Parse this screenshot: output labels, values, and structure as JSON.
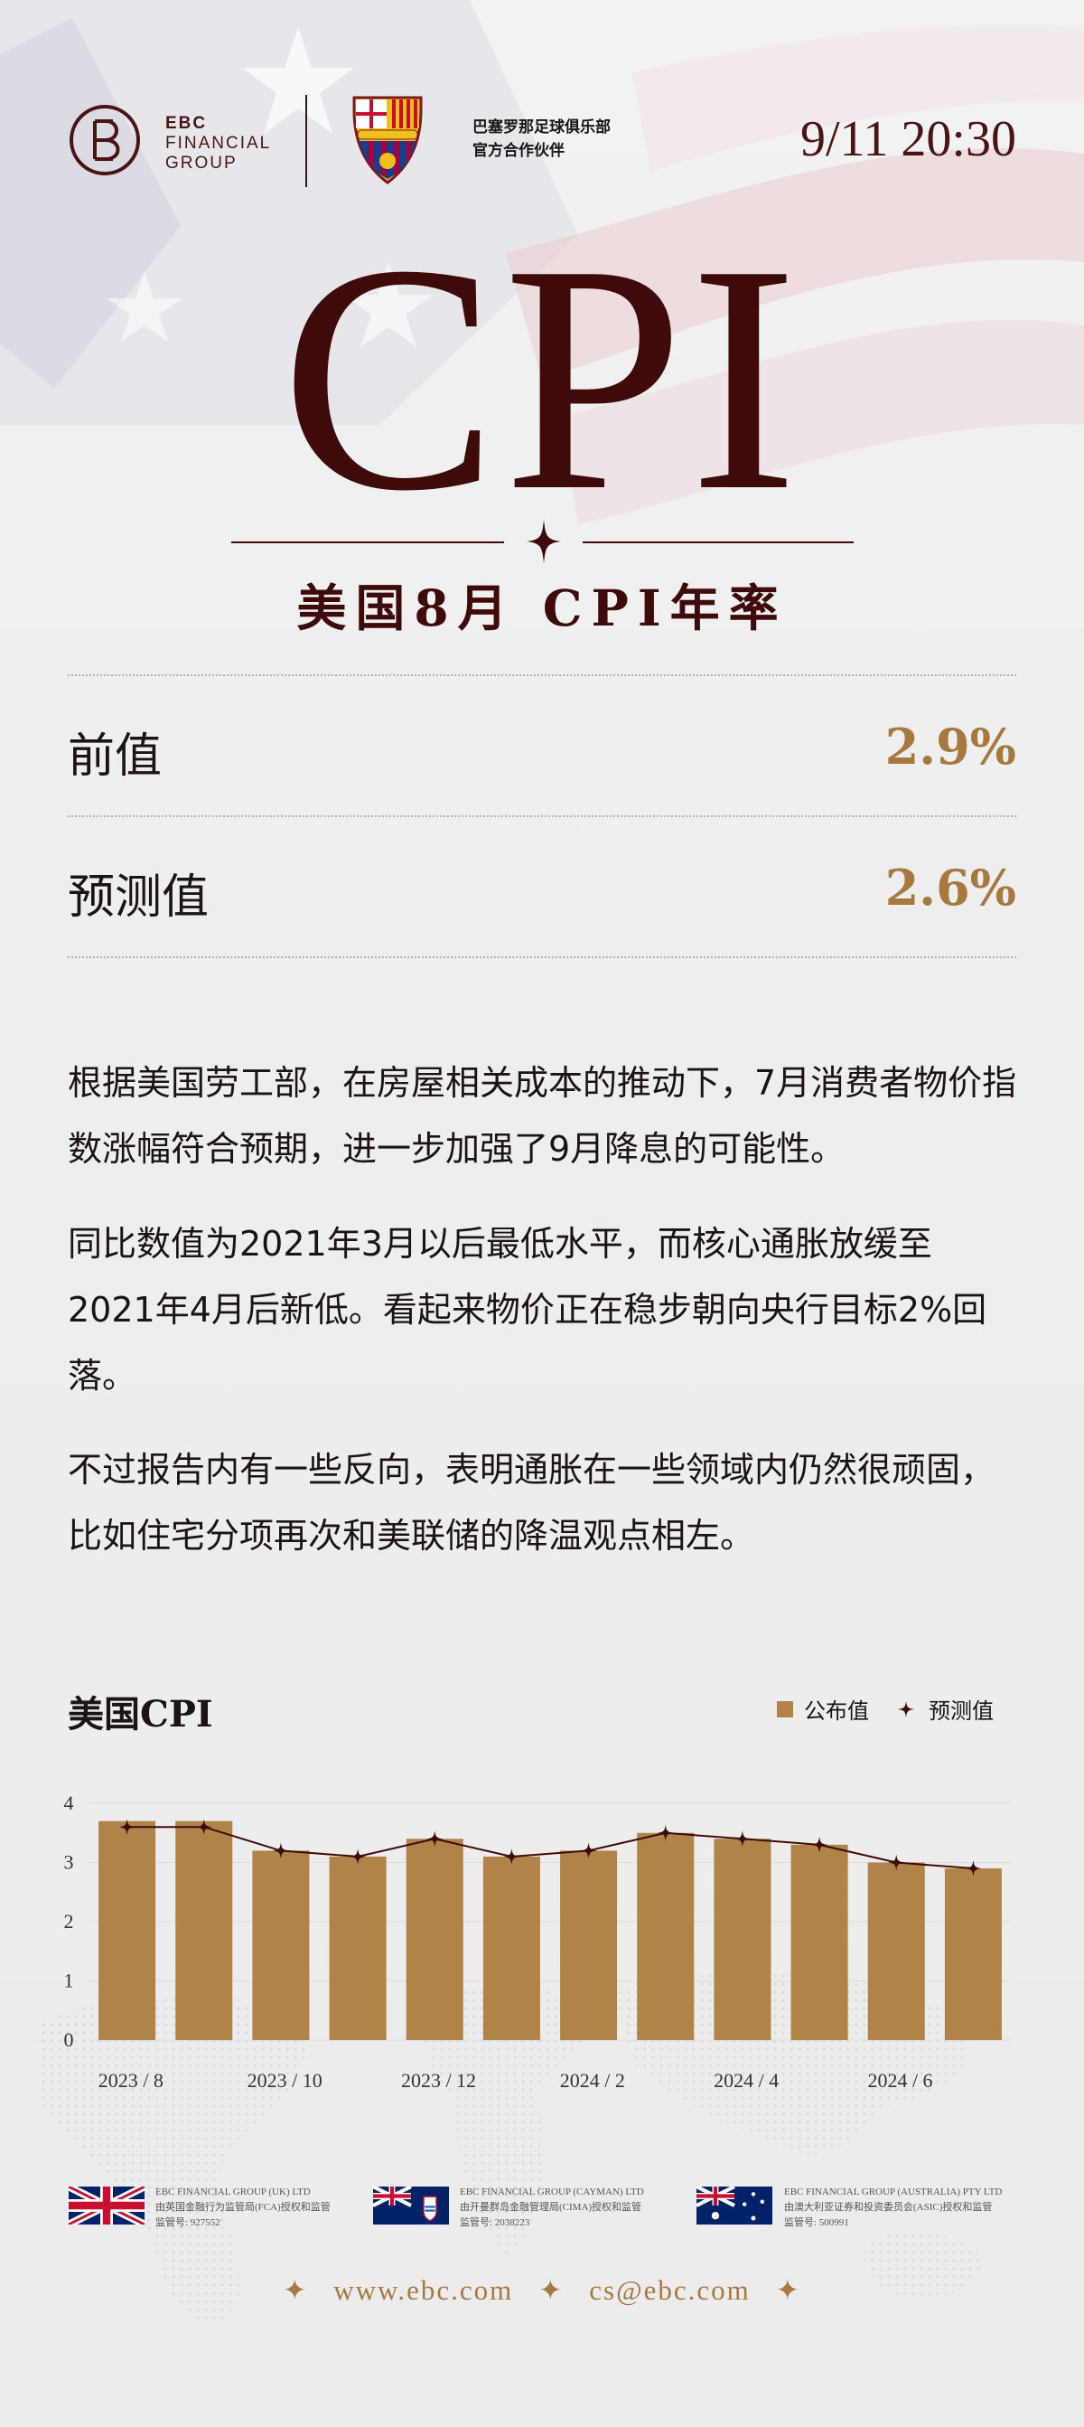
{
  "header": {
    "brand_line1": "EBC",
    "brand_line2": "FINANCIAL",
    "brand_line3": "GROUP",
    "partner_line1": "巴塞罗那足球俱乐部",
    "partner_line2": "官方合作伙伴",
    "datetime": "9/11 20:30"
  },
  "hero": {
    "title": "CPI",
    "subtitle": "美国8月 CPI年率"
  },
  "stats": [
    {
      "label": "前值",
      "value": "2.9%"
    },
    {
      "label": "预测值",
      "value": "2.6%"
    }
  ],
  "body": {
    "paragraphs": [
      "根据美国劳工部，在房屋相关成本的推动下，7月消费者物价指数涨幅符合预期，进一步加强了9月降息的可能性。",
      "同比数值为2021年3月以后最低水平，而核心通胀放缓至2021年4月后新低。看起来物价正在稳步朝向央行目标2%回落。",
      "不过报告内有一些反向，表明通胀在一些领域内仍然很顽固，比如住宅分项再次和美联储的降温观点相左。"
    ]
  },
  "chart_data": {
    "type": "bar",
    "title": "美国CPI",
    "categories": [
      "2023/8",
      "2023/9",
      "2023/10",
      "2023/11",
      "2023/12",
      "2024/1",
      "2024/2",
      "2024/3",
      "2024/4",
      "2024/5",
      "2024/6",
      "2024/7"
    ],
    "tick_labels": [
      "2023 / 8",
      "2023 / 10",
      "2023 / 12",
      "2024 / 2",
      "2024 / 4",
      "2024 / 6"
    ],
    "series": [
      {
        "name": "公布值",
        "type": "bar",
        "color": "#b08349",
        "values": [
          3.7,
          3.7,
          3.2,
          3.1,
          3.4,
          3.1,
          3.2,
          3.5,
          3.4,
          3.3,
          3.0,
          2.9
        ]
      },
      {
        "name": "预测值",
        "type": "line",
        "color": "#3e0a0a",
        "values": [
          3.6,
          3.6,
          3.2,
          3.1,
          3.4,
          3.1,
          3.2,
          3.5,
          3.4,
          3.3,
          3.0,
          2.9
        ]
      }
    ],
    "ylim": [
      0,
      4
    ],
    "yticks": [
      "0",
      "1",
      "2",
      "3",
      "4"
    ],
    "legend_position": "top-right",
    "grid": true
  },
  "footer": {
    "entities": [
      {
        "flag": "uk-flag",
        "name": "EBC FINANCIAL GROUP (UK) LTD",
        "line2": "由英国金融行为监管局(FCA)授权和监管",
        "line3": "监管号: 927552"
      },
      {
        "flag": "cayman-flag",
        "name": "EBC FINANCIAL GROUP (CAYMAN)  LTD",
        "line2": "由开曼群岛金融管理局(CIMA)授权和监管",
        "line3": "监管号: 2038223"
      },
      {
        "flag": "australia-flag",
        "name": "EBC FINANCIAL GROUP (AUSTRALIA)  PTY LTD",
        "line2": "由澳大利亚证券和投资委员会(ASIC)授权和监管",
        "line3": "监管号: 500991"
      }
    ],
    "website": "www.ebc.com",
    "email": "cs@ebc.com"
  },
  "colors": {
    "brand": "#3e0a0a",
    "gold": "#a8793f",
    "bar": "#b08349"
  }
}
